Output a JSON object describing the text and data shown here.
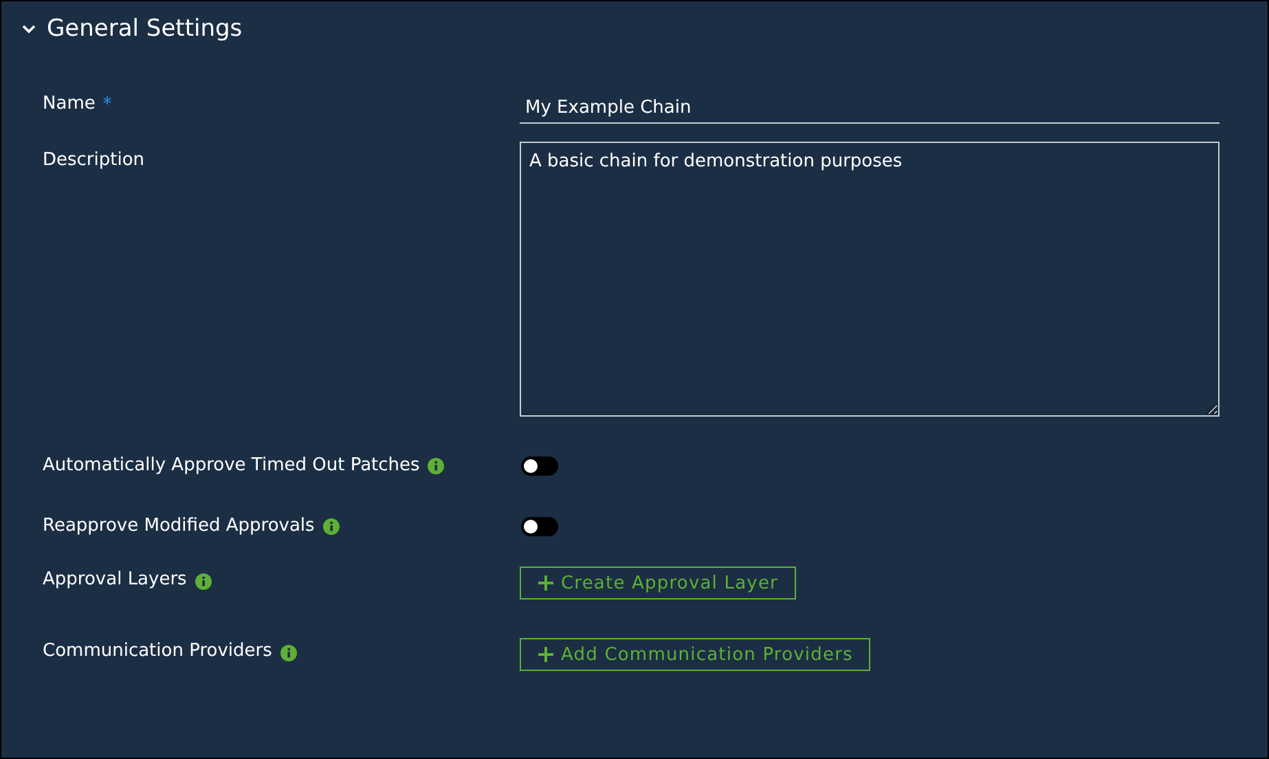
{
  "section": {
    "title": "General Settings",
    "expanded": true
  },
  "fields": [
    {
      "kind": "text",
      "label": "Name",
      "required": true,
      "value": "My Example Chain"
    },
    {
      "kind": "textarea",
      "label": "Description",
      "value": "A basic chain for demonstration purposes"
    },
    {
      "kind": "toggle",
      "label": "Automatically Approve Timed Out Patches",
      "info": true,
      "on": false
    },
    {
      "kind": "toggle",
      "label": "Reapprove Modified Approvals",
      "info": true,
      "on": false
    },
    {
      "kind": "button",
      "label": "Approval Layers",
      "info": true,
      "button": "Create Approval Layer"
    },
    {
      "kind": "button",
      "label": "Communication Providers",
      "info": true,
      "button": "Add Communication Providers"
    }
  ]
}
